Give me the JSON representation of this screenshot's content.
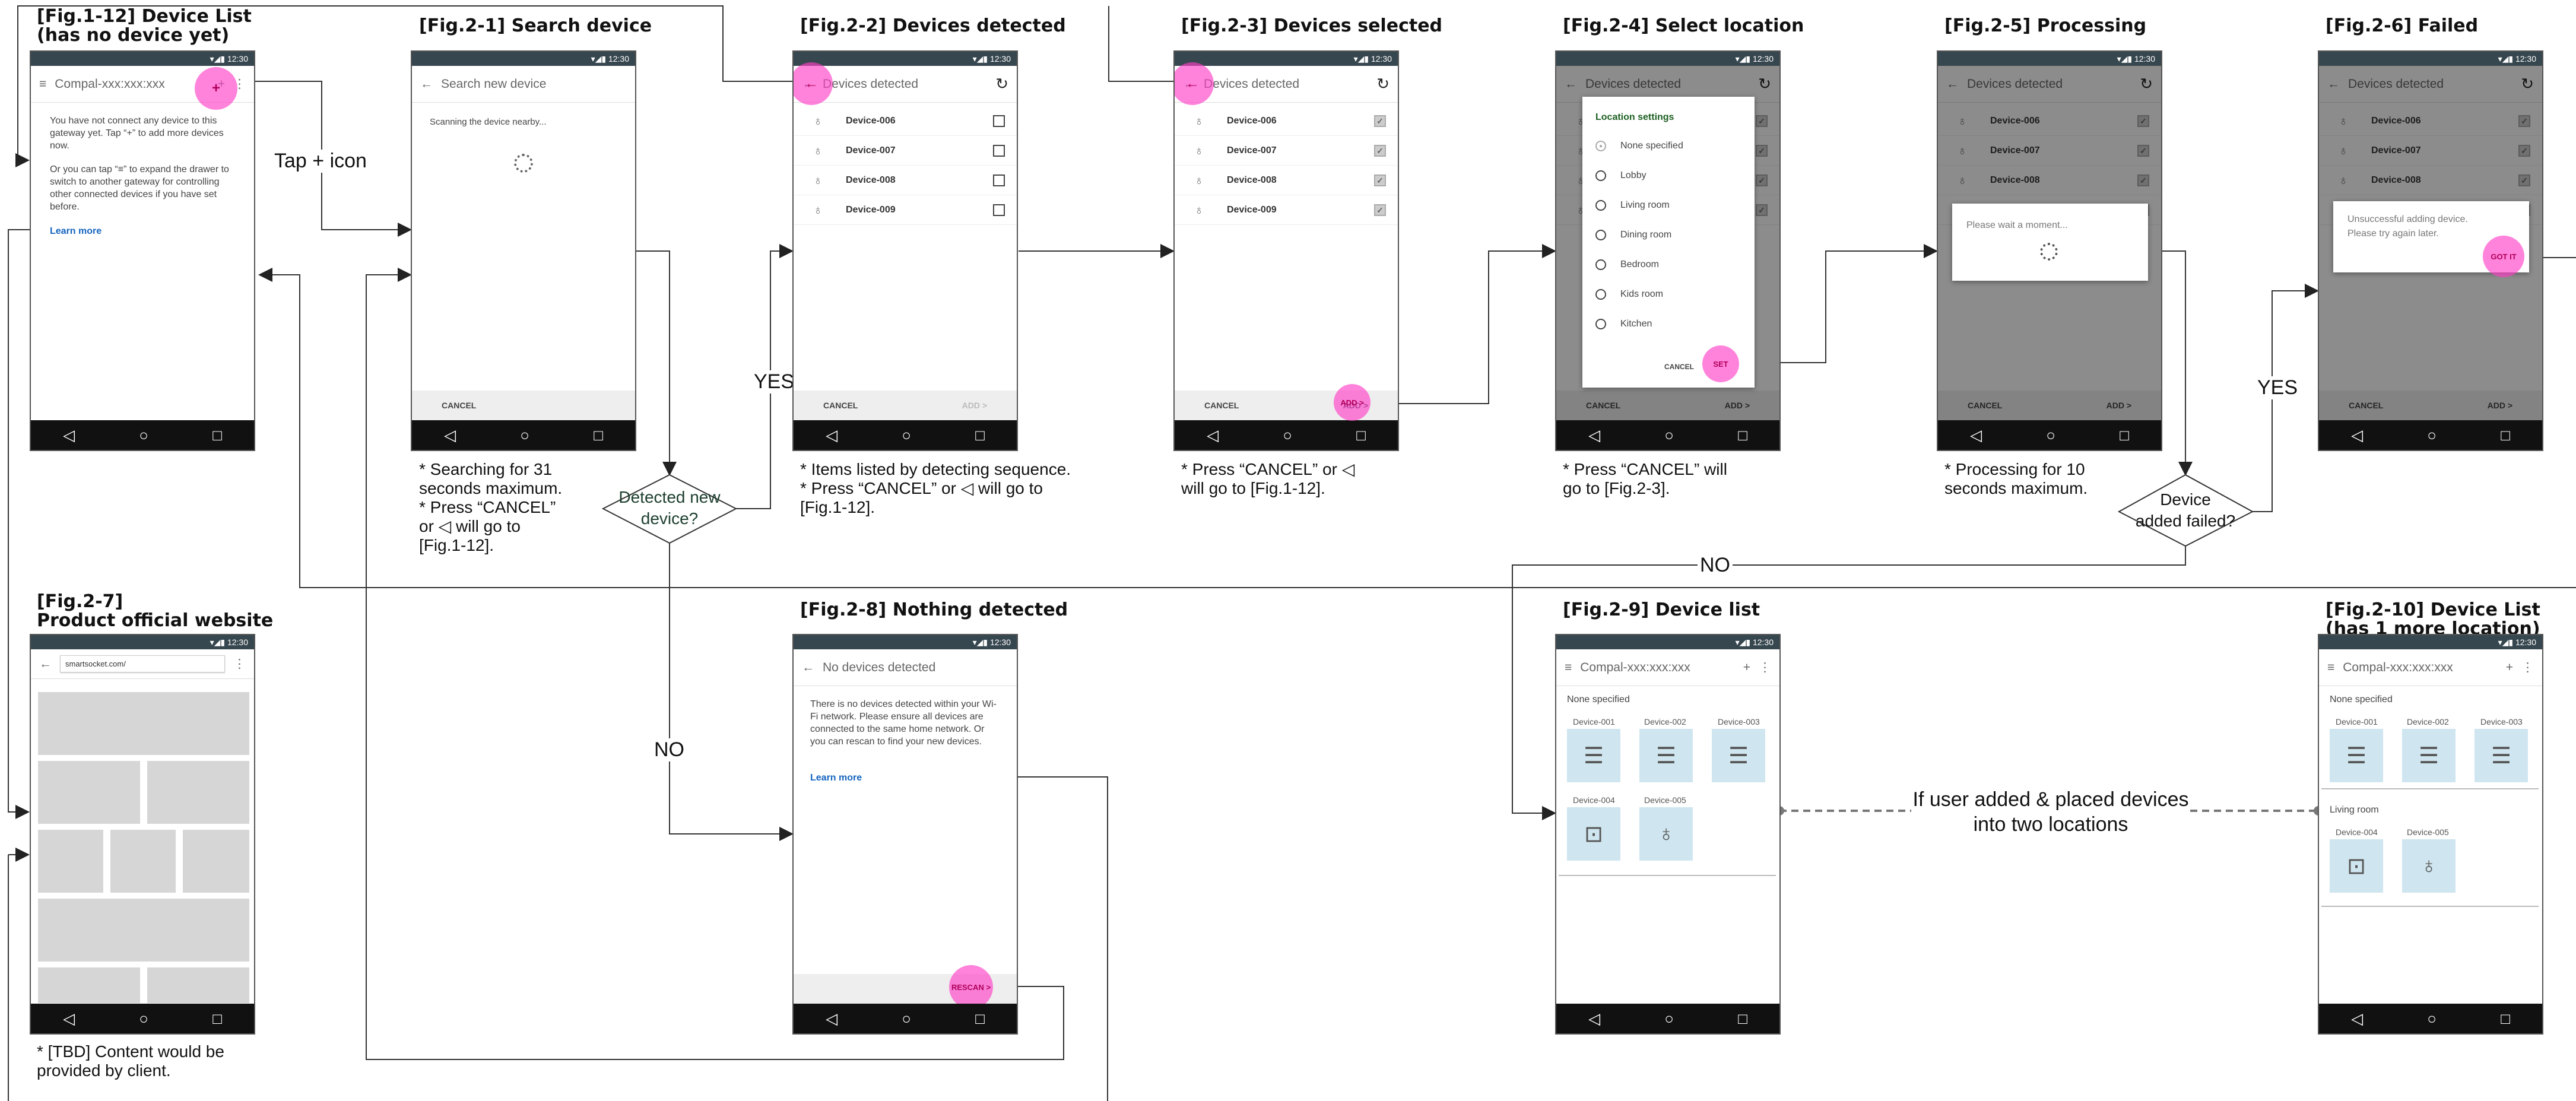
{
  "titles": {
    "f112": "[Fig.1-12] Device List",
    "f112b": "(has no device yet)",
    "f21": "[Fig.2-1] Search device",
    "f22": "[Fig.2-2] Devices detected",
    "f23": "[Fig.2-3] Devices selected",
    "f24": "[Fig.2-4] Select location",
    "f25": "[Fig.2-5] Processing",
    "f26": "[Fig.2-6] Failed",
    "f27": "[Fig.2-7]",
    "f27b": "Product official website",
    "f28": "[Fig.2-8] Nothing detected",
    "f29": "[Fig.2-9] Device list",
    "f210": "[Fig.2-10] Device List",
    "f210b": "(has 1 more location)"
  },
  "status_time": "12:30",
  "gateway_title": "Compal-xxx:xxx:xxx",
  "screens": {
    "s112": {
      "text1": "You have not connect any device to this gateway yet. Tap “+” to add more devices now.",
      "text2": "Or you can tap “≡” to expand the drawer to switch to another gateway for controlling other connected devices if you have set before.",
      "learn_more": "Learn more"
    },
    "s21": {
      "title": "Search new device",
      "scanning": "Scanning the device nearby...",
      "cancel": "CANCEL"
    },
    "s22": {
      "title": "Devices detected",
      "cancel": "CANCEL",
      "add": "ADD >"
    },
    "s24": {
      "dialog_title": "Location settings",
      "options": [
        "None specified",
        "Lobby",
        "Living room",
        "Dining room",
        "Bedroom",
        "Kids room",
        "Kitchen"
      ],
      "cancel": "CANCEL",
      "set": "SET"
    },
    "s25": {
      "wait": "Please wait a moment..."
    },
    "s26": {
      "fail1": "Unsuccessful adding device.",
      "fail2": "Please try again later.",
      "gotit": "GOT IT"
    },
    "s27": {
      "url": "smartsocket.com/"
    },
    "s28": {
      "title": "No devices detected",
      "text": "There is no devices detected within your Wi-Fi network. Please ensure all devices are connected to the same home network. Or you can rescan to find your new devices.",
      "learn_more": "Learn more",
      "rescan": "RESCAN >"
    },
    "s29": {
      "section": "None specified"
    },
    "s210": {
      "section1": "None specified",
      "section2": "Living room"
    }
  },
  "devices_list": [
    "Device-006",
    "Device-007",
    "Device-008",
    "Device-009"
  ],
  "tile_devices": [
    "Device-001",
    "Device-002",
    "Device-003",
    "Device-004",
    "Device-005"
  ],
  "notes": {
    "n21": [
      "* Searching for 31",
      "seconds maximum.",
      "* Press “CANCEL”",
      "or ◁ will go to",
      "[Fig.1-12]."
    ],
    "n22": [
      "* Items listed by detecting sequence.",
      "* Press “CANCEL” or ◁ will go to",
      "[Fig.1-12]."
    ],
    "n23": [
      "* Press “CANCEL” or ◁",
      "will go to [Fig.1-12]."
    ],
    "n24": [
      "* Press “CANCEL” will",
      "go to [Fig.2-3]."
    ],
    "n25": [
      "* Processing for 10",
      "seconds maximum."
    ],
    "n27": [
      "* [TBD] Content would be",
      "provided by client."
    ]
  },
  "flow_labels": {
    "tap_icon": "Tap + icon",
    "detected_q1": "Detected new",
    "detected_q2": "device?",
    "failed_q1": "Device",
    "failed_q2": "added failed?",
    "yes": "YES",
    "no": "NO",
    "placed1": "If user added & placed devices",
    "placed2": "into two locations"
  }
}
